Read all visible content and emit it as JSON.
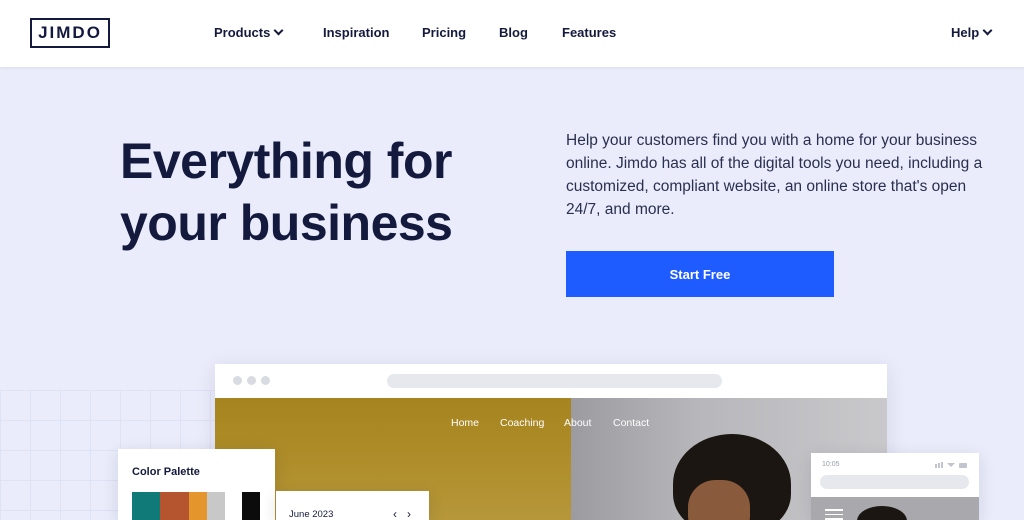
{
  "header": {
    "logo": "JIMDO",
    "nav": [
      {
        "label": "Products",
        "has_dropdown": true
      },
      {
        "label": "Inspiration",
        "has_dropdown": false
      },
      {
        "label": "Pricing",
        "has_dropdown": false
      },
      {
        "label": "Blog",
        "has_dropdown": false
      },
      {
        "label": "Features",
        "has_dropdown": false
      }
    ],
    "help": {
      "label": "Help",
      "has_dropdown": true
    }
  },
  "hero": {
    "title_line1": "Everything for",
    "title_line2": "your business",
    "description": "Help your customers find you with a home for your business online. Jimdo has all of the digital tools you need, including a customized, compliant website, an online store that's open 24/7, and more.",
    "cta": "Start Free"
  },
  "mockup": {
    "site_nav": [
      "Home",
      "Coaching",
      "About",
      "Contact"
    ],
    "palette_card": {
      "title": "Color Palette",
      "swatches": [
        "#0f7a78",
        "#b5552f",
        "#e4952c",
        "#c8c8c8",
        "#0c0c0c"
      ]
    },
    "calendar_card": {
      "month": "June 2023",
      "prev_icon": "chevron-left-icon",
      "next_icon": "chevron-right-icon"
    },
    "phone": {
      "time": "10:05"
    }
  },
  "colors": {
    "brand_navy": "#141a3d",
    "accent_blue": "#1f5cff",
    "hero_bg": "#eaecfb"
  }
}
